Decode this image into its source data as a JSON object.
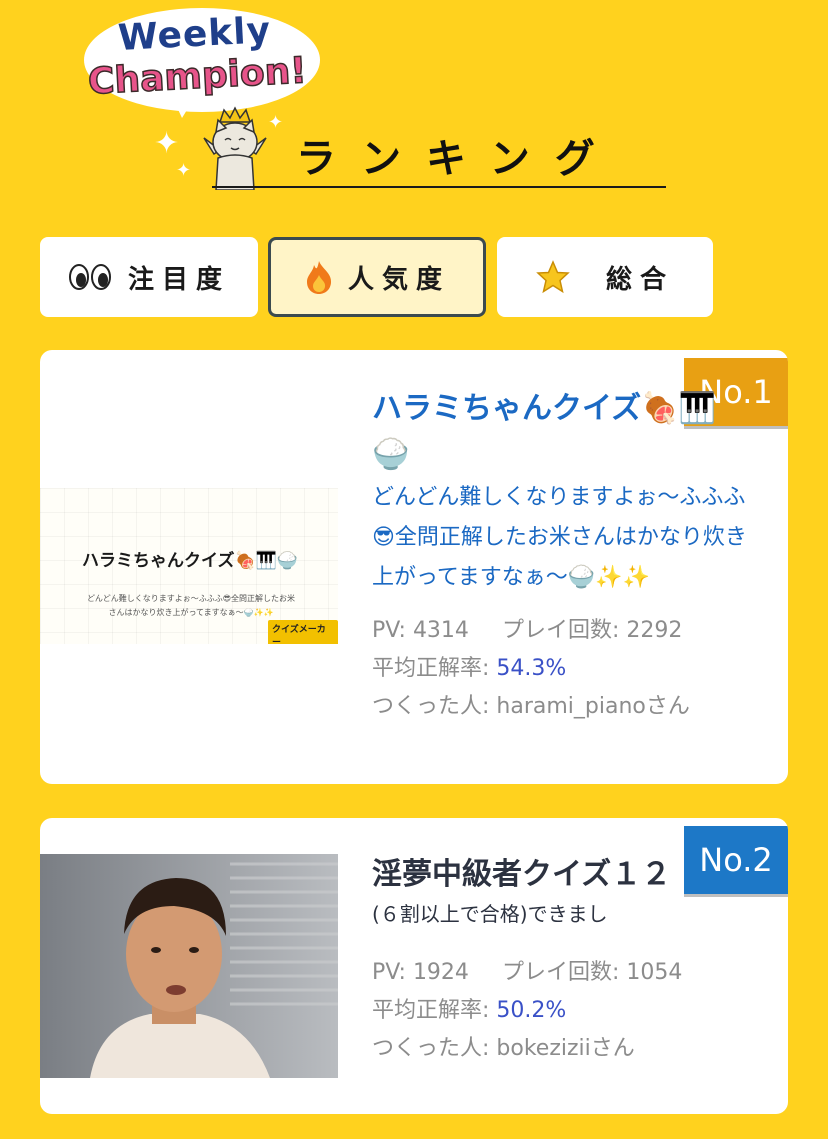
{
  "header": {
    "bubble_line1": "Weekly",
    "bubble_line2": "Champion!",
    "title": "ランキング",
    "sparkle_glyph": "✦"
  },
  "tabs": [
    {
      "label": "注目度",
      "icon": "eyes-icon",
      "active": false
    },
    {
      "label": "人気度",
      "icon": "fire-icon",
      "active": true
    },
    {
      "label": "総合",
      "icon": "star-icon",
      "active": false
    }
  ],
  "colors": {
    "background": "#ffd21e",
    "rank1_badge": "#e8a013",
    "rank2_badge": "#1d78c7",
    "title_blue": "#1b69c3",
    "accent_percent": "#3a51c7"
  },
  "cards": [
    {
      "rank": "No.1",
      "title": "ハラミちゃんクイズ🍖🎹",
      "title_tail": "🍚",
      "description": "どんどん難しくなりますよぉ〜ふふふ😎全問正解したお米さんはかなり炊き上がってますなぁ〜🍚✨✨",
      "thumbnail": {
        "title": "ハラミちゃんクイズ🍖🎹🍚",
        "desc": "どんどん難しくなりますよぉ〜ふふふ😎全問正解したお米さんはかなり炊き上がってますなぁ〜🍚✨✨",
        "logo": "クイズメーカー"
      },
      "pv_label": "PV:",
      "pv": "4314",
      "plays_label": "プレイ回数:",
      "plays": "2292",
      "accuracy_label": "平均正解率:",
      "accuracy": "54.3%",
      "creator_label": "つくった人:",
      "creator": "harami_pianoさん"
    },
    {
      "rank": "No.2",
      "title": "淫夢中級者クイズ１２",
      "description": "(６割以上で合格)できまし",
      "pv_label": "PV:",
      "pv": "1924",
      "plays_label": "プレイ回数:",
      "plays": "1054",
      "accuracy_label": "平均正解率:",
      "accuracy": "50.2%",
      "creator_label": "つくった人:",
      "creator": "bokeziziiさん"
    }
  ]
}
